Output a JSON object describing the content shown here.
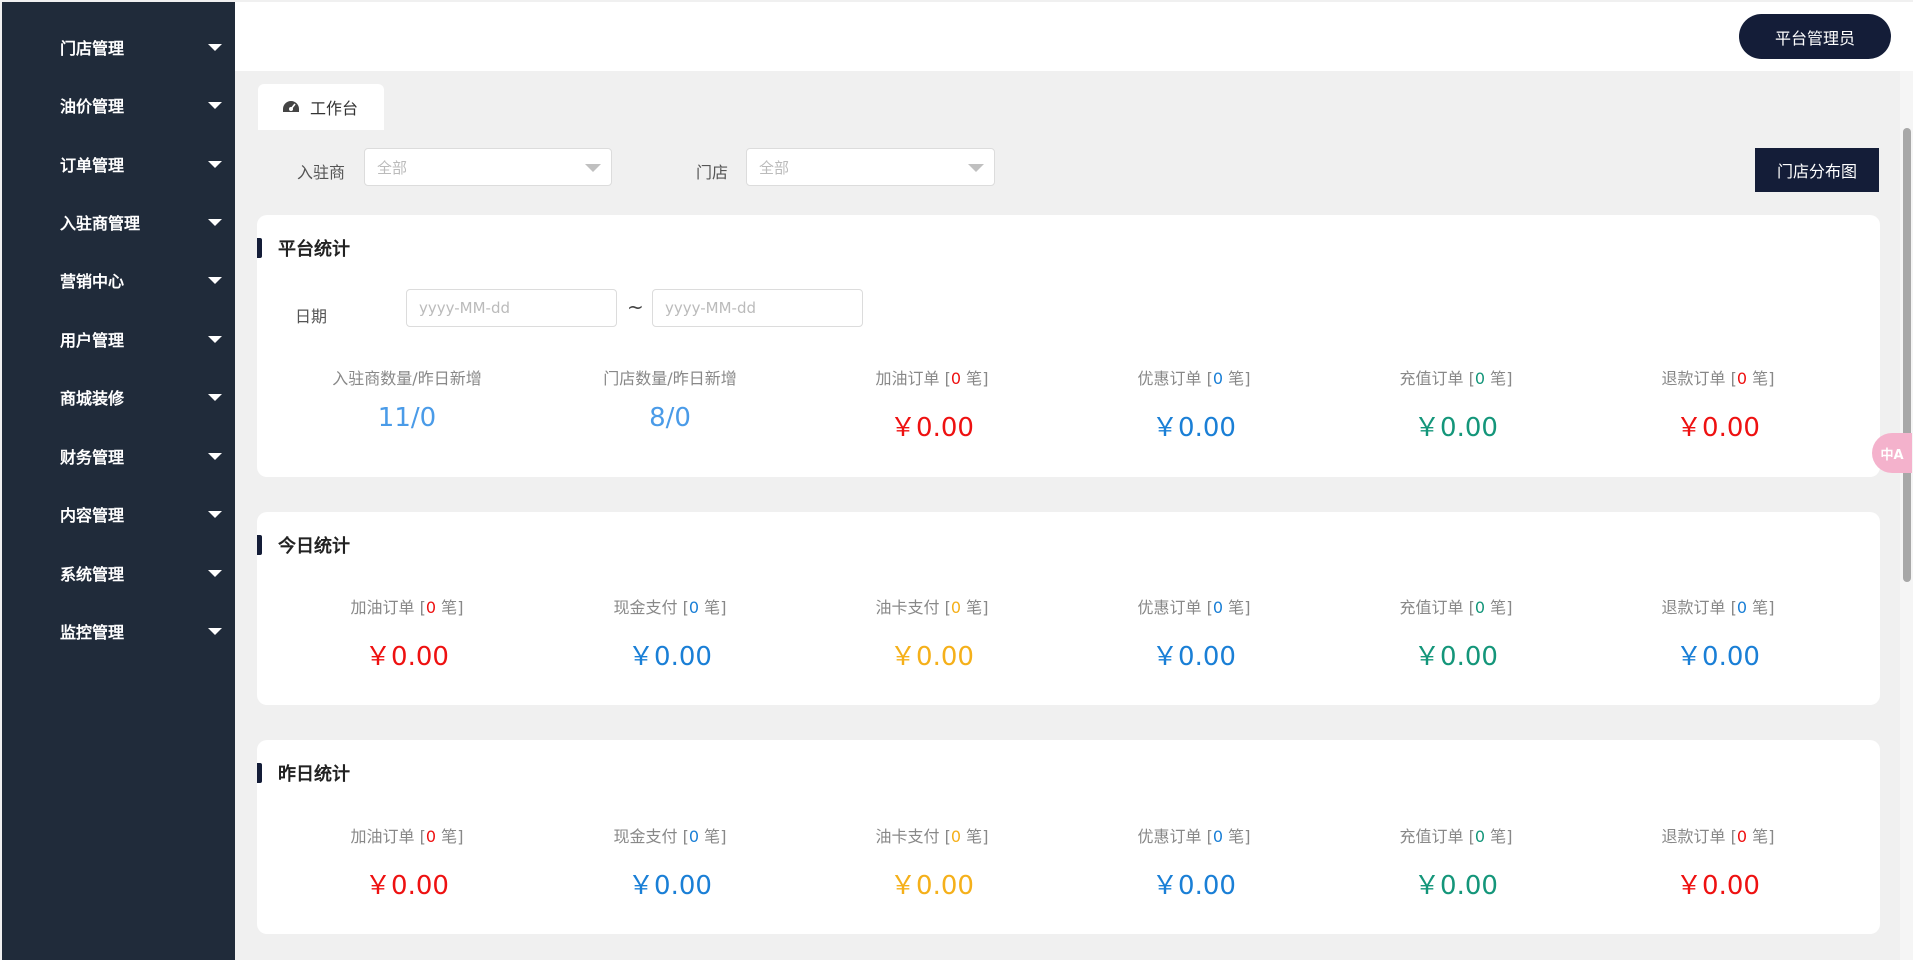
{
  "sidebar": {
    "items": [
      {
        "label": "门店管理"
      },
      {
        "label": "油价管理"
      },
      {
        "label": "订单管理"
      },
      {
        "label": "入驻商管理"
      },
      {
        "label": "营销中心"
      },
      {
        "label": "用户管理"
      },
      {
        "label": "商城装修"
      },
      {
        "label": "财务管理"
      },
      {
        "label": "内容管理"
      },
      {
        "label": "系统管理"
      },
      {
        "label": "监控管理"
      }
    ]
  },
  "header": {
    "user_button": "平台管理员"
  },
  "tab": {
    "label": "工作台"
  },
  "filters": {
    "merchant_label": "入驻商",
    "merchant_value": "全部",
    "store_label": "门店",
    "store_value": "全部",
    "map_button": "门店分布图"
  },
  "platform": {
    "title": "平台统计",
    "date_label": "日期",
    "start_placeholder": "yyyy-MM-dd",
    "end_placeholder": "yyyy-MM-dd",
    "separator": "~",
    "counts": [
      {
        "label": "入驻商数量/昨日新增",
        "value": "11/0"
      },
      {
        "label": "门店数量/昨日新增",
        "value": "8/0"
      }
    ],
    "stats": [
      {
        "name": "加油订单",
        "count": "0",
        "unit": "笔",
        "amount": "￥0.00",
        "color": "red"
      },
      {
        "name": "优惠订单",
        "count": "0",
        "unit": "笔",
        "amount": "￥0.00",
        "color": "blue"
      },
      {
        "name": "充值订单",
        "count": "0",
        "unit": "笔",
        "amount": "￥0.00",
        "color": "green"
      },
      {
        "name": "退款订单",
        "count": "0",
        "unit": "笔",
        "amount": "￥0.00",
        "color": "red"
      }
    ]
  },
  "today": {
    "title": "今日统计",
    "stats": [
      {
        "name": "加油订单",
        "count": "0",
        "unit": "笔",
        "amount": "￥0.00",
        "color": "red"
      },
      {
        "name": "现金支付",
        "count": "0",
        "unit": "笔",
        "amount": "￥0.00",
        "color": "blue"
      },
      {
        "name": "油卡支付",
        "count": "0",
        "unit": "笔",
        "amount": "￥0.00",
        "color": "yellow"
      },
      {
        "name": "优惠订单",
        "count": "0",
        "unit": "笔",
        "amount": "￥0.00",
        "color": "blue"
      },
      {
        "name": "充值订单",
        "count": "0",
        "unit": "笔",
        "amount": "￥0.00",
        "color": "green"
      },
      {
        "name": "退款订单",
        "count": "0",
        "unit": "笔",
        "amount": "￥0.00",
        "color": "blue"
      }
    ]
  },
  "yesterday": {
    "title": "昨日统计",
    "stats": [
      {
        "name": "加油订单",
        "count": "0",
        "unit": "笔",
        "amount": "￥0.00",
        "color": "red"
      },
      {
        "name": "现金支付",
        "count": "0",
        "unit": "笔",
        "amount": "￥0.00",
        "color": "blue"
      },
      {
        "name": "油卡支付",
        "count": "0",
        "unit": "笔",
        "amount": "￥0.00",
        "color": "yellow"
      },
      {
        "name": "优惠订单",
        "count": "0",
        "unit": "笔",
        "amount": "￥0.00",
        "color": "blue"
      },
      {
        "name": "充值订单",
        "count": "0",
        "unit": "笔",
        "amount": "￥0.00",
        "color": "green"
      },
      {
        "name": "退款订单",
        "count": "0",
        "unit": "笔",
        "amount": "￥0.00",
        "color": "red"
      }
    ]
  },
  "colors": {
    "sidebar_bg": "#202b3a",
    "accent": "#141d38",
    "red": "#ee1111",
    "blue": "#1a7fd6",
    "yellow": "#f5b01a",
    "green": "#14967a"
  },
  "translate": {
    "icon": "translate-icon",
    "text": "中A"
  }
}
